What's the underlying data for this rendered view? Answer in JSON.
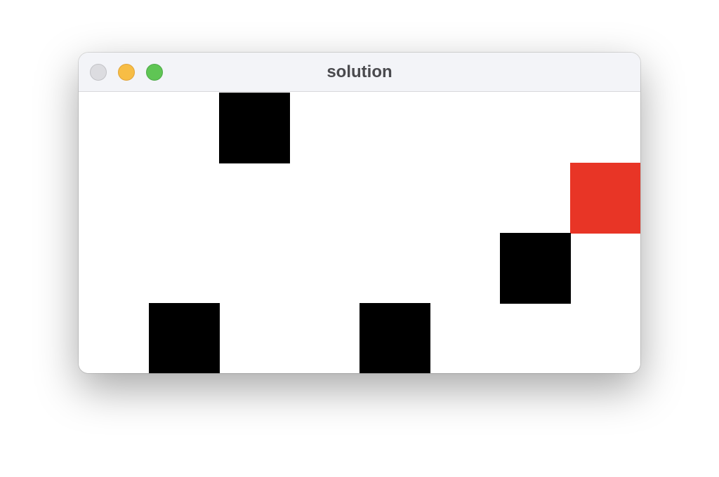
{
  "window": {
    "title": "solution",
    "controls": [
      {
        "name": "close",
        "color": "#dcdce0"
      },
      {
        "name": "minimize",
        "color": "#f7bd45"
      },
      {
        "name": "zoom",
        "color": "#5fc554"
      }
    ]
  },
  "game": {
    "grid_cols": 8,
    "grid_rows": 4,
    "background_color": "#ffffff",
    "tiles": [
      {
        "type": "wall",
        "col": 2,
        "row": 0,
        "color": "#000000"
      },
      {
        "type": "goal",
        "col": 7,
        "row": 1,
        "color": "#e83526"
      },
      {
        "type": "wall",
        "col": 6,
        "row": 2,
        "color": "#000000"
      },
      {
        "type": "wall",
        "col": 1,
        "row": 3,
        "color": "#000000"
      },
      {
        "type": "wall",
        "col": 4,
        "row": 3,
        "color": "#000000"
      }
    ]
  }
}
